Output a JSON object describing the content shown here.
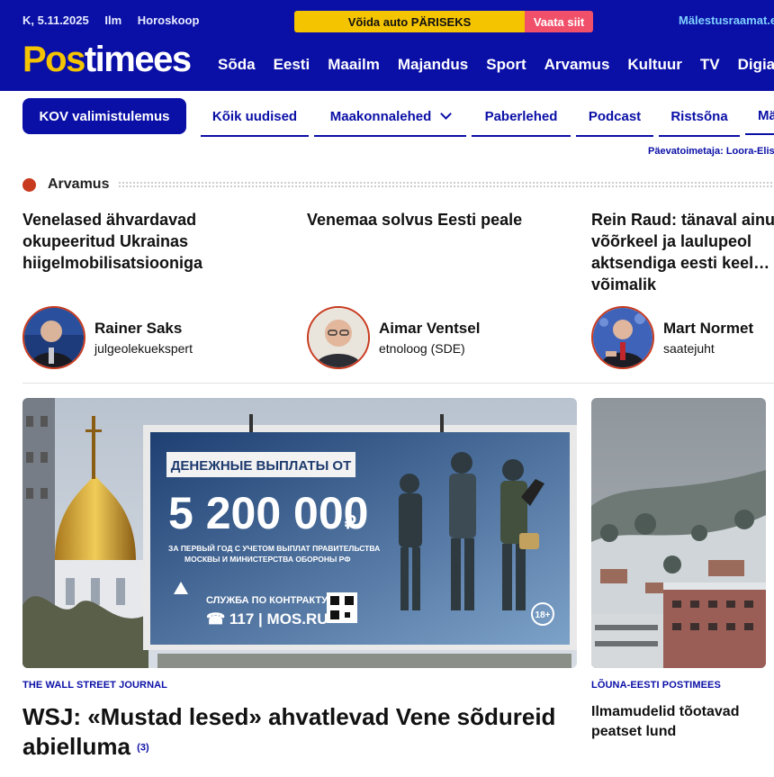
{
  "header": {
    "date": "K, 5.11.2025",
    "weather": "Ilm",
    "horoscope": "Horoskoop",
    "promo": "Võida auto PÄRISEKS",
    "promo_cta": "Vaata siit",
    "memorial": "Mälestusraamat.e",
    "logo_first": "Pos",
    "logo_rest": "timees",
    "nav": [
      "Sõda",
      "Eesti",
      "Maailm",
      "Majandus",
      "Sport",
      "Arvamus",
      "Kultuur",
      "TV",
      "Digiajak"
    ]
  },
  "subnav": {
    "kov": "KOV valimistulemus",
    "tabs": [
      "Kõik uudised",
      "Maakonnalehed",
      "Paberlehed",
      "Podcast",
      "Ristsõna",
      "Mä"
    ],
    "editor_label": "Päevatoimetaja:",
    "editor_name": "Loora-Elis"
  },
  "opinion": {
    "section": "Arvamus",
    "articles": [
      {
        "title": "Venelased ähvardavad okupeeritud Ukrainas hiigelmobilisatsiooniga",
        "author": "Rainer Saks",
        "role": "julgeolekuekspert"
      },
      {
        "title": "Venemaa solvus Eesti peale",
        "author": "Aimar Ventsel",
        "role": "etnoloog (SDE)"
      },
      {
        "title": "Rein Raud: tänaval ainu võõrkeel ja laulupeol aktsendiga eesti keel… võimalik",
        "author": "Mart Normet",
        "role": "saatejuht"
      }
    ]
  },
  "stories": {
    "main": {
      "source": "THE WALL STREET JOURNAL",
      "headline": "WSJ: «Mustad lesed» ahvatlevad Vene sõdureid abielluma",
      "comments": "(3)",
      "billboard": {
        "line1": "ДЕНЕЖНЫЕ ВЫПЛАТЫ ОТ",
        "amount": "5 200 000",
        "currency": "₽",
        "sub1": "ЗА ПЕРВЫЙ ГОД С УЧЕТОМ ВЫПЛАТ ПРАВИТЕЛЬСТВА",
        "sub2": "МОСКВЫ И МИНИСТЕРСТВА ОБОРОНЫ РФ",
        "service": "СЛУЖБА ПО КОНТРАКТУ",
        "phone": "☎ 117 | MOS.RU",
        "age": "18+"
      }
    },
    "side": {
      "source": "LÕUNA-EESTI POSTIMEES",
      "headline": "Ilmamudelid tõotavad peatset lund"
    }
  },
  "colors": {
    "brand": "#0a0fa6",
    "accent": "#f5c400",
    "promo_cta": "#f0506a",
    "opinion_dot": "#c83a1e"
  },
  "icons": [
    "chevron-down-icon",
    "section-dot-icon",
    "phone-icon"
  ]
}
